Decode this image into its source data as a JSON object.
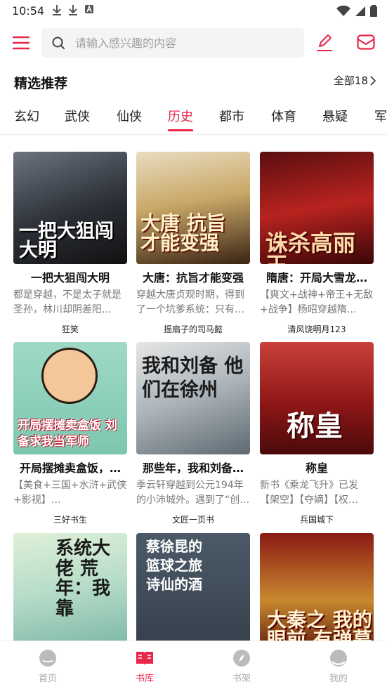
{
  "status_bar": {
    "time": "10:54"
  },
  "search": {
    "placeholder": "请输入感兴趣的内容"
  },
  "section": {
    "title": "精选推荐",
    "all_label": "全部18"
  },
  "tabs": [
    "玄幻",
    "武侠",
    "仙侠",
    "历史",
    "都市",
    "体育",
    "悬疑",
    "军"
  ],
  "active_tab": "历史",
  "books": [
    {
      "title": "一把大狙闯大明",
      "desc": "都是穿越，不是太子就是圣孙，林川却阴差阳…",
      "author": "狂笑",
      "cover_text": "一把大狙闯大明"
    },
    {
      "title": "大唐：抗旨才能变强",
      "desc": "穿越大唐贞观时期，得到了一个坑爹系统：只有…",
      "author": "摇扇子的司马懿",
      "cover_text": "大唐 抗旨 才能变强"
    },
    {
      "title": "隋唐：开局大雪龙…",
      "desc": "【爽文+战神+帝王+无敌+战争】杨昭穿越隋…",
      "author": "清风饶明月123",
      "cover_text": "诛杀高丽王"
    },
    {
      "title": "开局摆摊卖盒饭，…",
      "desc": "【美食+三国+水浒+武侠+影视】…",
      "author": "三好书生",
      "cover_text": "开局摆摊卖盒饭 刘备求我当军师"
    },
    {
      "title": "那些年，我和刘备…",
      "desc": "季云轩穿越到公元194年的小沛城外。遇到了“创…",
      "author": "文匠一页书",
      "cover_text": "我和刘备 他们在徐州"
    },
    {
      "title": "称皇",
      "desc": "新书《乘龙飞升》已发【架空】【夺嫡】【权…",
      "author": "兵国城下",
      "cover_text": "称皇"
    },
    {
      "title": "",
      "desc": "",
      "author": "",
      "cover_text": "系统大佬 荒年：我靠"
    },
    {
      "title": "",
      "desc": "",
      "author": "",
      "cover_text": "蔡徐昆的篮球之旅 诗仙的酒"
    },
    {
      "title": "",
      "desc": "",
      "author": "",
      "cover_text": "大秦之 我的眼前 有弹幕"
    }
  ],
  "bottom_nav": [
    {
      "label": "首页",
      "icon": "home-face-icon"
    },
    {
      "label": "书库",
      "icon": "book-icon"
    },
    {
      "label": "书架",
      "icon": "compass-icon"
    },
    {
      "label": "我的",
      "icon": "profile-face-icon"
    }
  ],
  "active_nav": "书库",
  "colors": {
    "accent": "#e8264a",
    "muted": "#aaaaaa"
  }
}
